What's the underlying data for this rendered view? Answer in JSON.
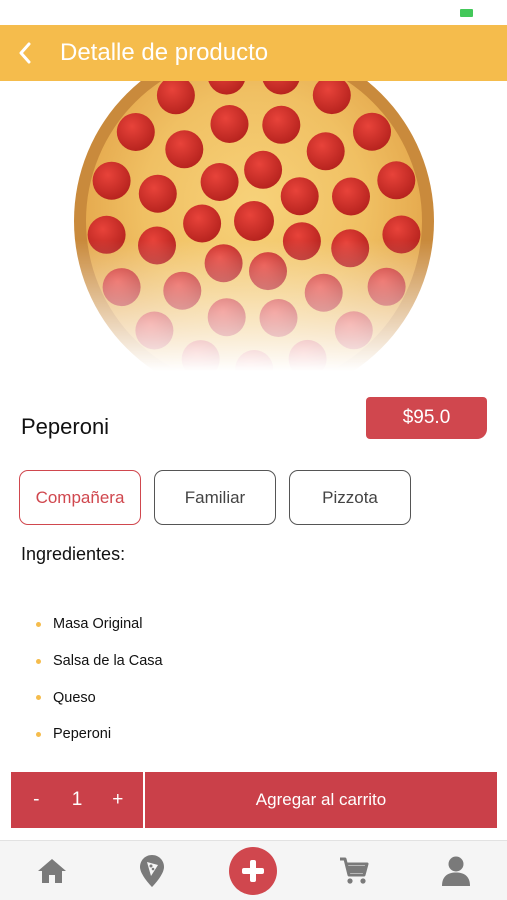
{
  "header": {
    "title": "Detalle de producto",
    "back_icon": "chevron-left-icon"
  },
  "product": {
    "name": "Peperoni",
    "price": "$95.0",
    "image": "pepperoni-pizza"
  },
  "sizes": [
    {
      "label": "Compañera",
      "selected": true
    },
    {
      "label": "Familiar",
      "selected": false
    },
    {
      "label": "Pizzota",
      "selected": false
    }
  ],
  "ingredients": {
    "title": "Ingredientes:",
    "items": [
      "Masa Original",
      "Salsa de la Casa",
      "Queso",
      "Peperoni"
    ]
  },
  "cart": {
    "decrement": "-",
    "quantity": "1",
    "increment": "+",
    "add_label": "Agregar al carrito"
  },
  "nav": {
    "items": [
      "home-icon",
      "pizza-location-icon",
      "plus-icon",
      "cart-icon",
      "user-icon"
    ]
  },
  "colors": {
    "header": "#f5bc4c",
    "accent": "#d0474e",
    "button": "#ca4049"
  }
}
